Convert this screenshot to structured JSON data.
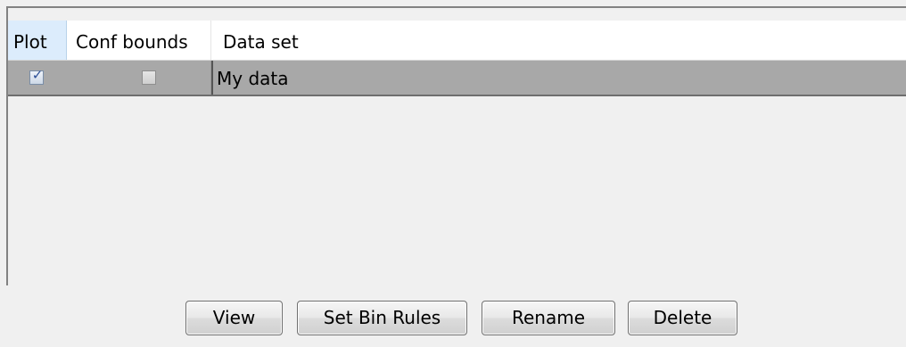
{
  "table": {
    "columns": {
      "plot": "Plot",
      "conf_bounds": "Conf bounds",
      "data_set": "Data set"
    },
    "rows": [
      {
        "plot_checked": true,
        "conf_checked": false,
        "name": "My data"
      }
    ]
  },
  "buttons": {
    "view": "View",
    "set_bin_rules": "Set Bin Rules",
    "rename": "Rename",
    "delete": "Delete"
  },
  "icons": {
    "checkbox_checked": "checkbox-checked-icon",
    "checkbox_unchecked": "checkbox-unchecked-icon"
  },
  "colors": {
    "header_selected": "#dcecfc",
    "row_selected": "#a8a8a8",
    "check_mark": "#2b4f96"
  }
}
